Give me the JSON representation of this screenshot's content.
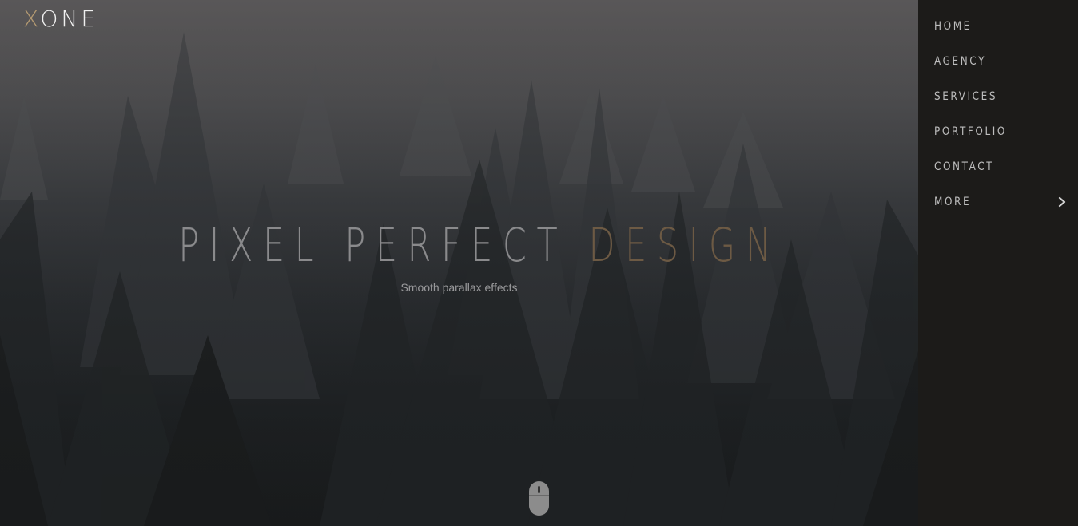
{
  "logo": {
    "first_letter": "X",
    "rest": "ONE"
  },
  "hero": {
    "title_main": "PIXEL PERFECT ",
    "title_accent": "DESIGN",
    "subtitle": "Smooth parallax effects",
    "scroll_icon": "mouse-icon"
  },
  "nav": {
    "items": [
      {
        "label": "HOME"
      },
      {
        "label": "AGENCY"
      },
      {
        "label": "SERVICES"
      },
      {
        "label": "PORTFOLIO"
      },
      {
        "label": "CONTACT"
      },
      {
        "label": "MORE",
        "icon": "chevron-right-icon"
      }
    ]
  },
  "colors": {
    "accent": "#b49a72",
    "title_accent": "#6d5a44",
    "nav_background": "#1c1b19",
    "nav_text": "#bdbdbd"
  }
}
